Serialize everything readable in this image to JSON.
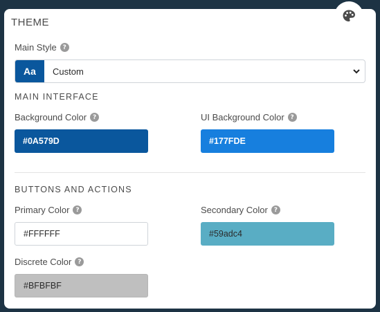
{
  "theme": {
    "title": "THEME",
    "main_style": {
      "label": "Main Style",
      "icon_text": "Aa",
      "value": "Custom"
    },
    "main_interface": {
      "heading": "MAIN INTERFACE",
      "background_color": {
        "label": "Background Color",
        "value": "#0A579D"
      },
      "ui_background_color": {
        "label": "UI Background Color",
        "value": "#177FDE"
      }
    },
    "buttons_actions": {
      "heading": "BUTTONS AND ACTIONS",
      "primary_color": {
        "label": "Primary Color",
        "value": "#FFFFFF"
      },
      "secondary_color": {
        "label": "Secondary Color",
        "value": "#59adc4"
      },
      "discrete_color": {
        "label": "Discrete Color",
        "value": "#BFBFBF"
      }
    }
  },
  "colors": {
    "page_background": "#1d3344",
    "panel": "#ffffff",
    "accent": "#0A579D"
  },
  "icons": {
    "palette": "palette-icon",
    "help": "help-icon",
    "caret": "chevron-down-icon"
  }
}
